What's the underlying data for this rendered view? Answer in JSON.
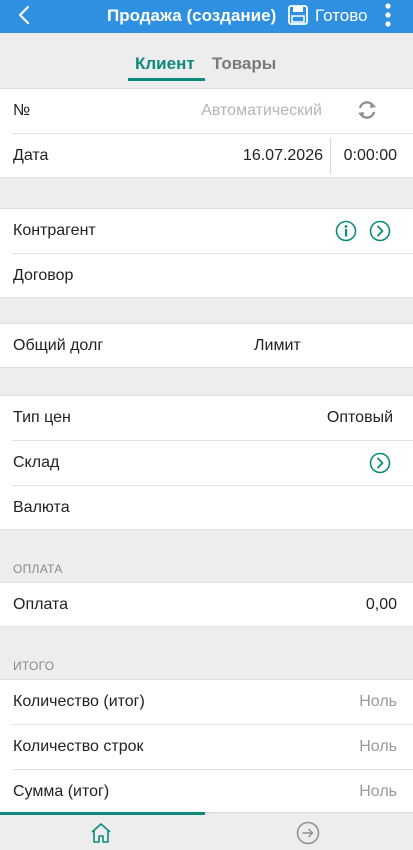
{
  "appbar": {
    "title": "Продажа (создание)",
    "done_label": "Готово"
  },
  "tabs": {
    "client": "Клиент",
    "goods": "Товары"
  },
  "header_group": {
    "number_label": "№",
    "number_placeholder": "Автоматический",
    "date_label": "Дата",
    "date_value": "16.07.2026",
    "time_value": "0:00:00"
  },
  "party_group": {
    "counterparty_label": "Контрагент",
    "contract_label": "Договор"
  },
  "debt_group": {
    "total_debt_label": "Общий долг",
    "limit_label": "Лимит"
  },
  "settings_group": {
    "price_type_label": "Тип цен",
    "price_type_value": "Оптовый",
    "warehouse_label": "Склад",
    "currency_label": "Валюта"
  },
  "payment_section": {
    "header": "ОПЛАТА",
    "payment_label": "Оплата",
    "payment_value": "0,00"
  },
  "totals_section": {
    "header": "ИТОГО",
    "qty_label": "Количество (итог)",
    "qty_value": "Ноль",
    "rows_label": "Количество строк",
    "rows_value": "Ноль",
    "sum_label": "Сумма (итог)",
    "sum_value": "Ноль"
  },
  "colors": {
    "accent": "#0e8a7d",
    "appbar": "#2f8fe0"
  }
}
